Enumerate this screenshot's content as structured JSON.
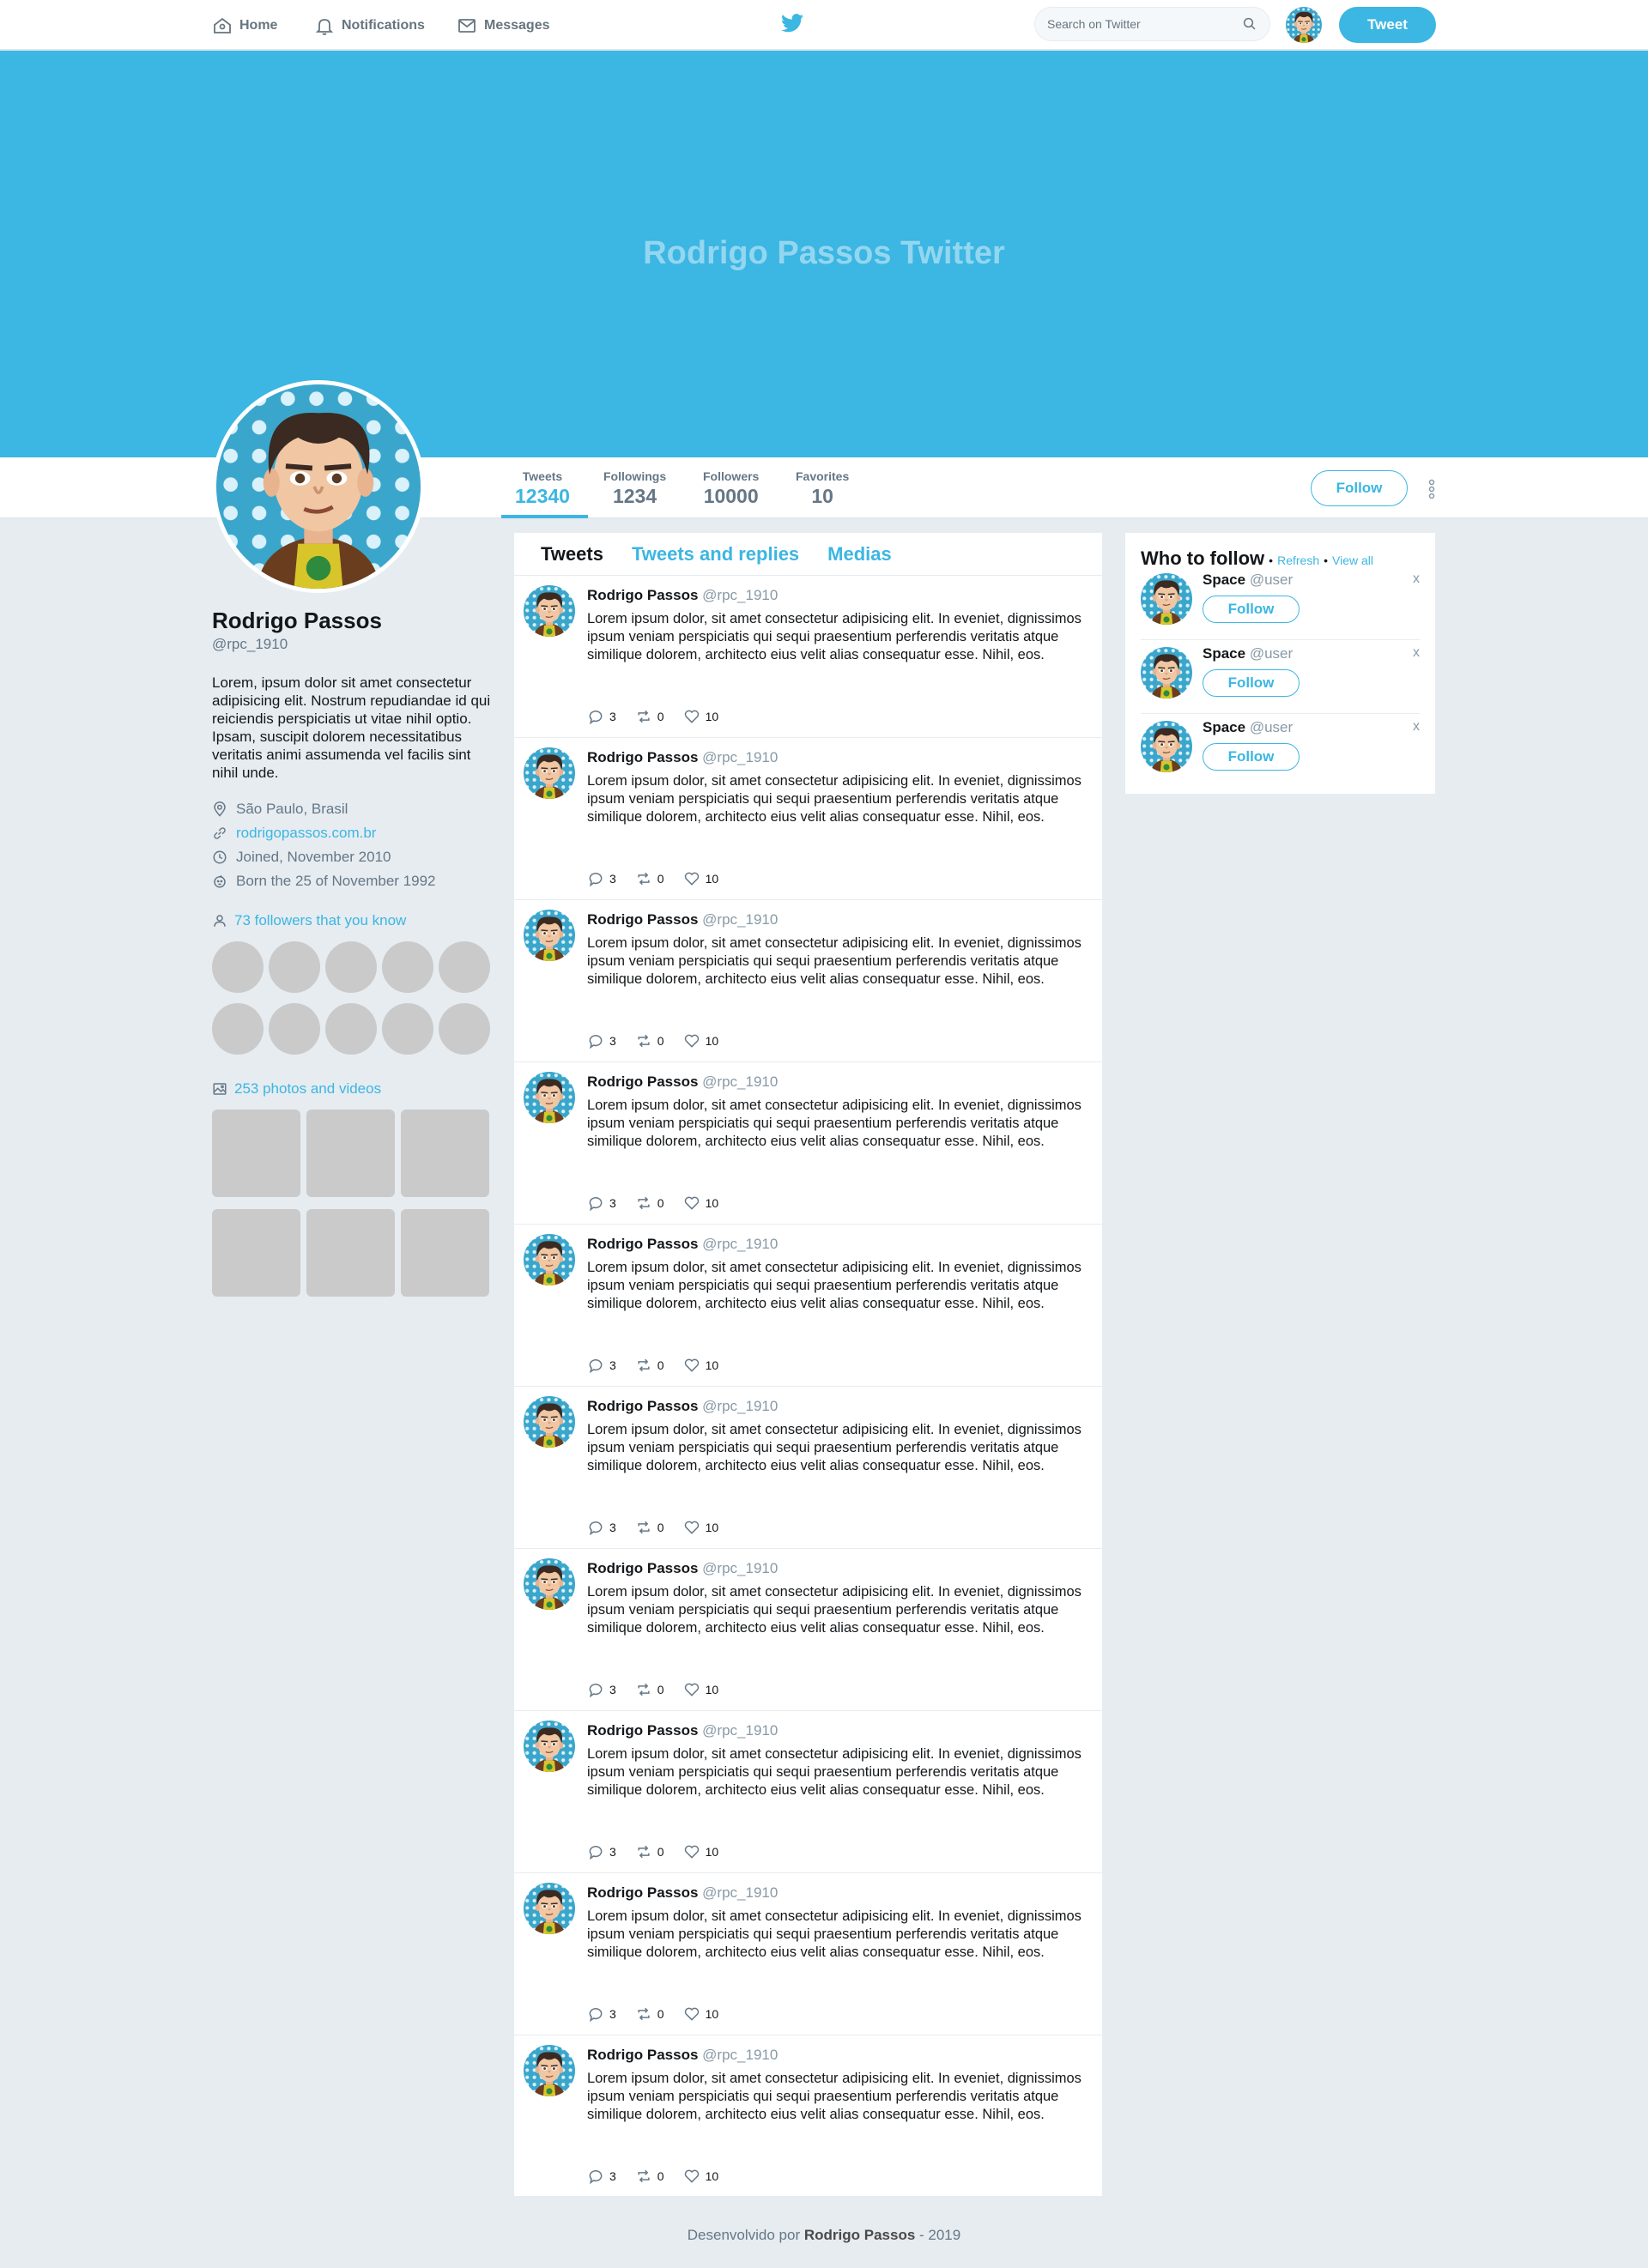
{
  "nav": {
    "home": "Home",
    "notifications": "Notifications",
    "messages": "Messages",
    "search_placeholder": "Search on Twitter",
    "tweet_button": "Tweet"
  },
  "banner": {
    "title": "Rodrigo Passos Twitter"
  },
  "stats": [
    {
      "label": "Tweets",
      "value": "12340"
    },
    {
      "label": "Followings",
      "value": "1234"
    },
    {
      "label": "Followers",
      "value": "10000"
    },
    {
      "label": "Favorites",
      "value": "10"
    }
  ],
  "profile_follow_label": "Follow",
  "profile": {
    "name": "Rodrigo Passos",
    "handle": "@rpc_1910",
    "bio": "Lorem, ipsum dolor sit amet consectetur adipisicing elit. Nostrum repudiandae id qui reiciendis perspiciatis ut vitae nihil optio. Ipsam, suscipit dolorem necessitatibus veritatis animi assumenda vel facilis sint nihil unde.",
    "location": "São Paulo, Brasil",
    "website": "rodrigopassos.com.br",
    "joined": "Joined, November 2010",
    "born": "Born the 25 of November 1992",
    "followers_you_know": "73 followers that you know",
    "photos_videos": "253 photos and videos"
  },
  "tabs": [
    "Tweets",
    "Tweets and replies",
    "Medias"
  ],
  "tweets": [
    {
      "name": "Rodrigo Passos",
      "handle": "@rpc_1910",
      "text": "Lorem ipsum dolor, sit amet consectetur adipisicing elit. In eveniet, dignissimos ipsum veniam perspiciatis qui sequi praesentium perferendis veritatis atque similique dolorem, architecto eius velit alias consequatur esse. Nihil, eos.",
      "replies": "3",
      "retweets": "0",
      "likes": "10"
    },
    {
      "name": "Rodrigo Passos",
      "handle": "@rpc_1910",
      "text": "Lorem ipsum dolor, sit amet consectetur adipisicing elit. In eveniet, dignissimos ipsum veniam perspiciatis qui sequi praesentium perferendis veritatis atque similique dolorem, architecto eius velit alias consequatur esse. Nihil, eos.",
      "replies": "3",
      "retweets": "0",
      "likes": "10"
    },
    {
      "name": "Rodrigo Passos",
      "handle": "@rpc_1910",
      "text": "Lorem ipsum dolor, sit amet consectetur adipisicing elit. In eveniet, dignissimos ipsum veniam perspiciatis qui sequi praesentium perferendis veritatis atque similique dolorem, architecto eius velit alias consequatur esse. Nihil, eos.",
      "replies": "3",
      "retweets": "0",
      "likes": "10"
    },
    {
      "name": "Rodrigo Passos",
      "handle": "@rpc_1910",
      "text": "Lorem ipsum dolor, sit amet consectetur adipisicing elit. In eveniet, dignissimos ipsum veniam perspiciatis qui sequi praesentium perferendis veritatis atque similique dolorem, architecto eius velit alias consequatur esse. Nihil, eos.",
      "replies": "3",
      "retweets": "0",
      "likes": "10"
    },
    {
      "name": "Rodrigo Passos",
      "handle": "@rpc_1910",
      "text": "Lorem ipsum dolor, sit amet consectetur adipisicing elit. In eveniet, dignissimos ipsum veniam perspiciatis qui sequi praesentium perferendis veritatis atque similique dolorem, architecto eius velit alias consequatur esse. Nihil, eos.",
      "replies": "3",
      "retweets": "0",
      "likes": "10"
    },
    {
      "name": "Rodrigo Passos",
      "handle": "@rpc_1910",
      "text": "Lorem ipsum dolor, sit amet consectetur adipisicing elit. In eveniet, dignissimos ipsum veniam perspiciatis qui sequi praesentium perferendis veritatis atque similique dolorem, architecto eius velit alias consequatur esse. Nihil, eos.",
      "replies": "3",
      "retweets": "0",
      "likes": "10"
    },
    {
      "name": "Rodrigo Passos",
      "handle": "@rpc_1910",
      "text": "Lorem ipsum dolor, sit amet consectetur adipisicing elit. In eveniet, dignissimos ipsum veniam perspiciatis qui sequi praesentium perferendis veritatis atque similique dolorem, architecto eius velit alias consequatur esse. Nihil, eos.",
      "replies": "3",
      "retweets": "0",
      "likes": "10"
    },
    {
      "name": "Rodrigo Passos",
      "handle": "@rpc_1910",
      "text": "Lorem ipsum dolor, sit amet consectetur adipisicing elit. In eveniet, dignissimos ipsum veniam perspiciatis qui sequi praesentium perferendis veritatis atque similique dolorem, architecto eius velit alias consequatur esse. Nihil, eos.",
      "replies": "3",
      "retweets": "0",
      "likes": "10"
    },
    {
      "name": "Rodrigo Passos",
      "handle": "@rpc_1910",
      "text": "Lorem ipsum dolor, sit amet consectetur adipisicing elit. In eveniet, dignissimos ipsum veniam perspiciatis qui sequi praesentium perferendis veritatis atque similique dolorem, architecto eius velit alias consequatur esse. Nihil, eos.",
      "replies": "3",
      "retweets": "0",
      "likes": "10"
    },
    {
      "name": "Rodrigo Passos",
      "handle": "@rpc_1910",
      "text": "Lorem ipsum dolor, sit amet consectetur adipisicing elit. In eveniet, dignissimos ipsum veniam perspiciatis qui sequi praesentium perferendis veritatis atque similique dolorem, architecto eius velit alias consequatur esse. Nihil, eos.",
      "replies": "3",
      "retweets": "0",
      "likes": "10"
    }
  ],
  "who_to_follow": {
    "title": "Who to follow",
    "refresh": "Refresh",
    "view_all": "View all",
    "follow_label": "Follow",
    "users": [
      {
        "name": "Space",
        "handle": "@user"
      },
      {
        "name": "Space",
        "handle": "@user"
      },
      {
        "name": "Space",
        "handle": "@user"
      }
    ]
  },
  "footer": {
    "prefix": "Desenvolvido por",
    "author": "Rodrigo Passos",
    "suffix": "- 2019"
  },
  "colors": {
    "accent": "#3cb6e2",
    "background": "#e6ecf0",
    "placeholder": "#cacaca"
  }
}
